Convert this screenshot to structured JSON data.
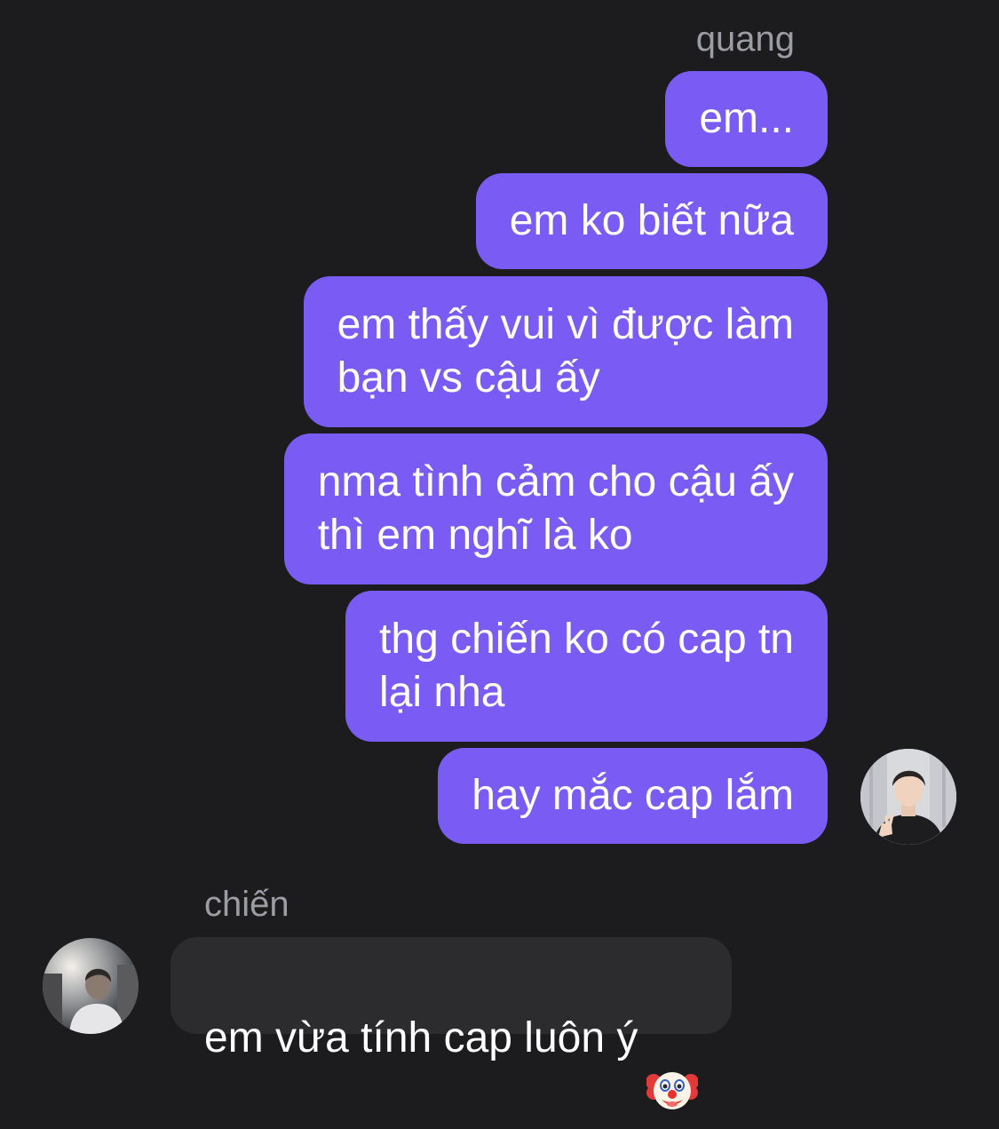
{
  "chat": {
    "outgoing": {
      "sender": "quang",
      "messages": [
        "em...",
        "em ko biết nữa",
        "em thấy vui vì được làm\nbạn vs cậu ấy",
        "nma tình cảm cho cậu ấy\nthì em nghĩ là ko",
        "thg chiến ko có cap tn\nlại nha",
        "hay mắc cap lắm"
      ]
    },
    "incoming": {
      "sender": "chiến",
      "messages": [
        "em vừa tính cap luôn ý"
      ],
      "emoji": "clown-face-emoji"
    }
  },
  "colors": {
    "background": "#1c1c1f",
    "outgoing_bubble": "#7a5cf5",
    "incoming_bubble": "#2c2c2f",
    "sender_name": "#9c9ca3"
  }
}
